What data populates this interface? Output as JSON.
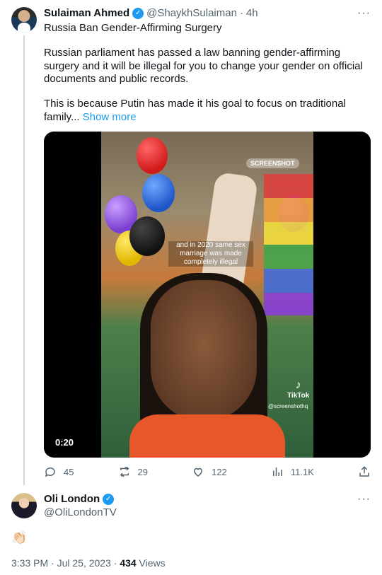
{
  "tweet1": {
    "name": "Sulaiman Ahmed",
    "handle": "@ShaykhSulaiman",
    "separator": "·",
    "time_ago": "4h",
    "title_line": "Russia Ban Gender-Affirming Surgery",
    "paragraph1": "Russian parliament has passed a law banning gender-affirming surgery and it will be illegal for you to change your gender on official documents and public records.",
    "paragraph2": "This is because Putin has made it his goal to focus on traditional family...",
    "show_more": "Show more",
    "video": {
      "badge": "SCREENSHOT",
      "caption": "and in 2020 same sex marriage was made completely illegal",
      "tiktok_label": "TikTok",
      "tiktok_handle": "@screenshothq",
      "duration": "0:20"
    },
    "actions": {
      "replies": "45",
      "retweets": "29",
      "likes": "122",
      "views": "11.1K"
    }
  },
  "tweet2": {
    "name": "Oli London",
    "handle": "@OliLondonTV",
    "content": "👏🏻"
  },
  "footer": {
    "timestamp": "3:33 PM · Jul 25, 2023 · ",
    "views_count": "434",
    "views_label": " Views"
  },
  "icons": [
    "verified-badge-icon",
    "more-icon",
    "reply-icon",
    "retweet-icon",
    "like-icon",
    "views-icon",
    "share-icon",
    "tiktok-icon"
  ],
  "colors": {
    "accent": "#1d9bf0",
    "muted": "#536471",
    "text": "#0f1419"
  }
}
